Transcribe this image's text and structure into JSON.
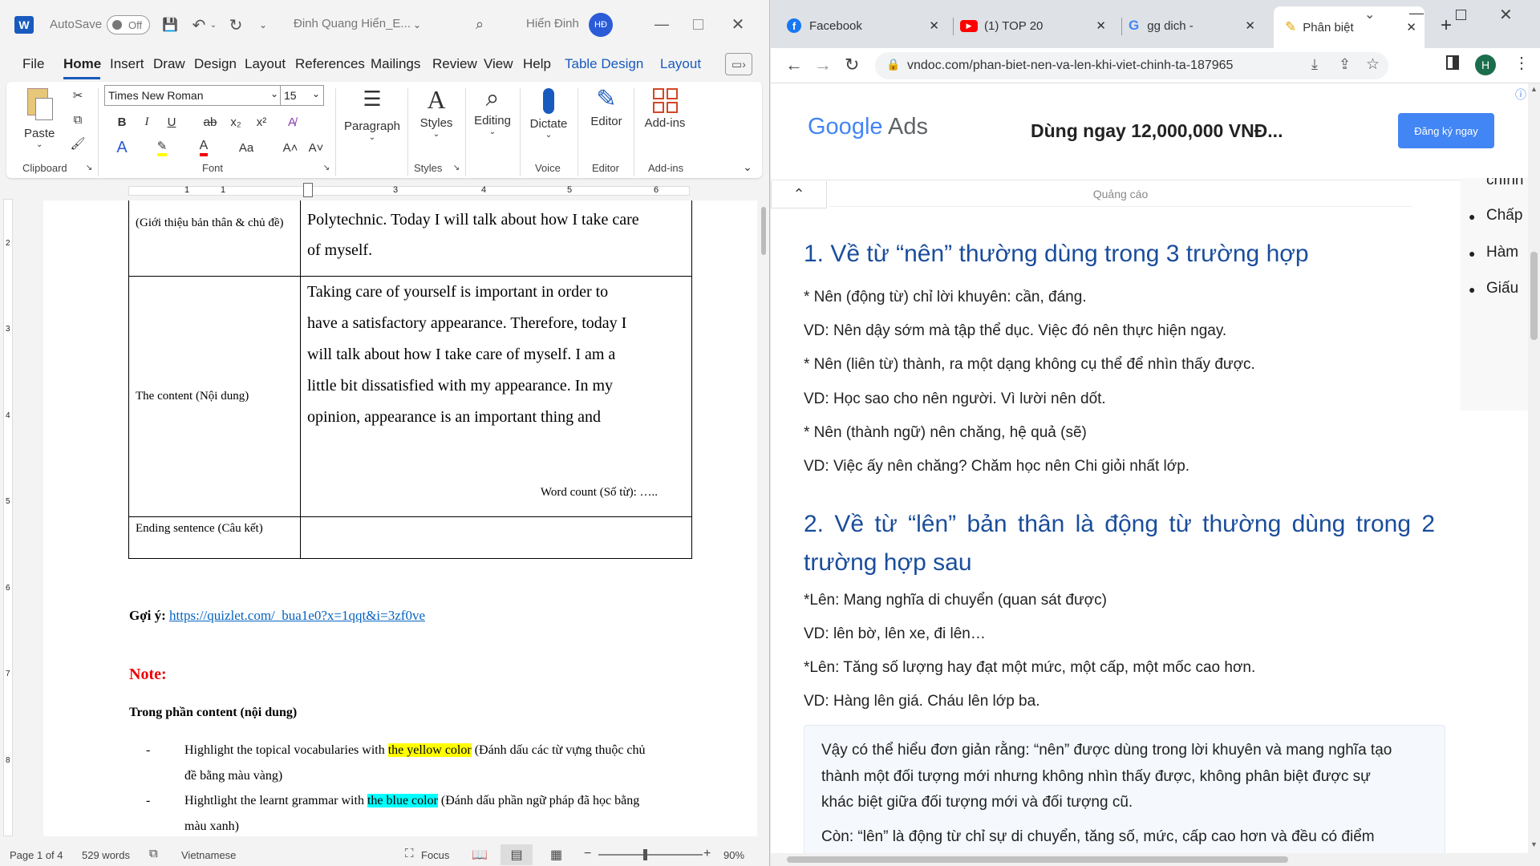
{
  "word": {
    "autosave_label": "AutoSave",
    "autosave_state": "Off",
    "doc_title": "Đinh Quang Hiển_E...",
    "user_name": "Hiển Đinh",
    "user_initials": "HĐ",
    "menu": [
      "File",
      "Home",
      "Insert",
      "Draw",
      "Design",
      "Layout",
      "References",
      "Mailings",
      "Review",
      "View",
      "Help",
      "Table Design",
      "Layout"
    ],
    "ribbon": {
      "paste": "Paste",
      "clipboard": "Clipboard",
      "font_name": "Times New Roman",
      "font_size": "15",
      "font_group": "Font",
      "paragraph": "Paragraph",
      "styles": "Styles",
      "styles_group": "Styles",
      "editing": "Editing",
      "dictate": "Dictate",
      "voice_group": "Voice",
      "editor": "Editor",
      "editor_group": "Editor",
      "addins": "Add-ins",
      "addins_group": "Add-ins",
      "bold": "B",
      "italic": "I",
      "underline": "U",
      "strike": "ab",
      "sub": "x₂",
      "sup": "x²",
      "case": "Aa"
    },
    "ruler_numbers": [
      "1",
      "1",
      "2",
      "3",
      "4",
      "5",
      "6"
    ],
    "vruler_numbers": [
      "2",
      "3",
      "4",
      "5",
      "6",
      "7",
      "8"
    ],
    "table": {
      "row1_label": "(Giới thiệu bản thân & chủ đề)",
      "row1_text_line1": "Polytechnic. Today I will talk about how I take care",
      "row1_text_line2": "of myself.",
      "row2_label": "The content (Nội dung)",
      "row2_lines": [
        "Taking care of yourself is important in order to",
        "have a satisfactory appearance. Therefore, today I",
        "will talk about how I take care of myself. I am a",
        "little bit dissatisfied with my appearance. In my",
        "opinion, appearance is an important thing and"
      ],
      "word_count": "Word count (Số từ): …..",
      "row3_label": "Ending sentence (Câu kết)"
    },
    "hint_label": "Gợi ý:",
    "hint_link": "https://quizlet.com/_bua1e0?x=1qqt&i=3zf0ve",
    "note": "Note:",
    "content_heading": "Trong phần content (nội dung)",
    "bullet1_before": "Highlight the topical vocabularies with ",
    "bullet1_highlight": "the yellow color",
    "bullet1_after": " (Đánh dấu các từ vựng thuộc chủ",
    "bullet1_line2": "đề bằng màu vàng)",
    "bullet2_before": "Hightlight the learnt grammar with ",
    "bullet2_highlight": "the blue color",
    "bullet2_after": " (Đánh dấu phần ngữ pháp đã học bằng",
    "bullet2_line2": "màu xanh)",
    "status": {
      "page": "Page 1 of 4",
      "words": "529 words",
      "language": "Vietnamese",
      "focus": "Focus",
      "zoom": "90%"
    }
  },
  "chrome": {
    "tabs": [
      "Facebook",
      "(1) TOP 20",
      "gg dich - ",
      "Phân biệt"
    ],
    "url": "vndoc.com/phan-biet-nen-va-len-khi-viet-chinh-ta-187965",
    "profile_initial": "H",
    "ad": {
      "brand_google": "Google",
      "brand_ads": "Ads",
      "headline": "Dùng ngay 12,000,000 VNĐ...",
      "cta": "Đăng ký ngay",
      "label": "Quảng cáo"
    },
    "side_items": [
      "chính",
      "Chấp",
      "Hàm",
      "Giấu"
    ],
    "h1": "1. Về từ “nên” thường dùng trong 3 trường hợp",
    "p1": "* Nên (động từ) chỉ lời khuyên: cần, đáng.",
    "p2": "VD: Nên dậy sớm mà tập thể dục. Việc đó nên thực hiện ngay.",
    "p3": "* Nên (liên từ) thành, ra một dạng không cụ thể để nhìn thấy được.",
    "p4": "VD: Học sao cho nên người. Vì lười nên dốt.",
    "p5": "* Nên (thành ngữ) nên chăng, hệ quả (sẽ)",
    "p6": "VD: Việc ấy nên chăng? Chăm học nên Chi giỏi nhất lớp.",
    "h2_line1": "2. Về từ “lên” bản thân là động từ thường dùng trong 2",
    "h2_line2": "trường hợp sau",
    "p7": "*Lên: Mang nghĩa di chuyển (quan sát được)",
    "p8": "VD: lên bờ, lên xe, đi lên…",
    "p9": "*Lên: Tăng số lượng hay đạt một mức, một cấp, một mốc cao hơn.",
    "p10": "VD: Hàng lên giá. Cháu lên lớp ba.",
    "box_line1": "Vậy có thể hiểu đơn giản rằng: “nên” được dùng trong lời khuyên và mang nghĩa tạo",
    "box_line2": "thành một đối tượng mới nhưng không nhìn thấy được, không phân biệt được sự",
    "box_line3": "khác biệt giữa đối tượng mới và đối tượng cũ.",
    "box_line4": "Còn: “lên” là động từ chỉ sự di chuyển, tăng số, mức, cấp cao hơn và đều có điểm"
  }
}
